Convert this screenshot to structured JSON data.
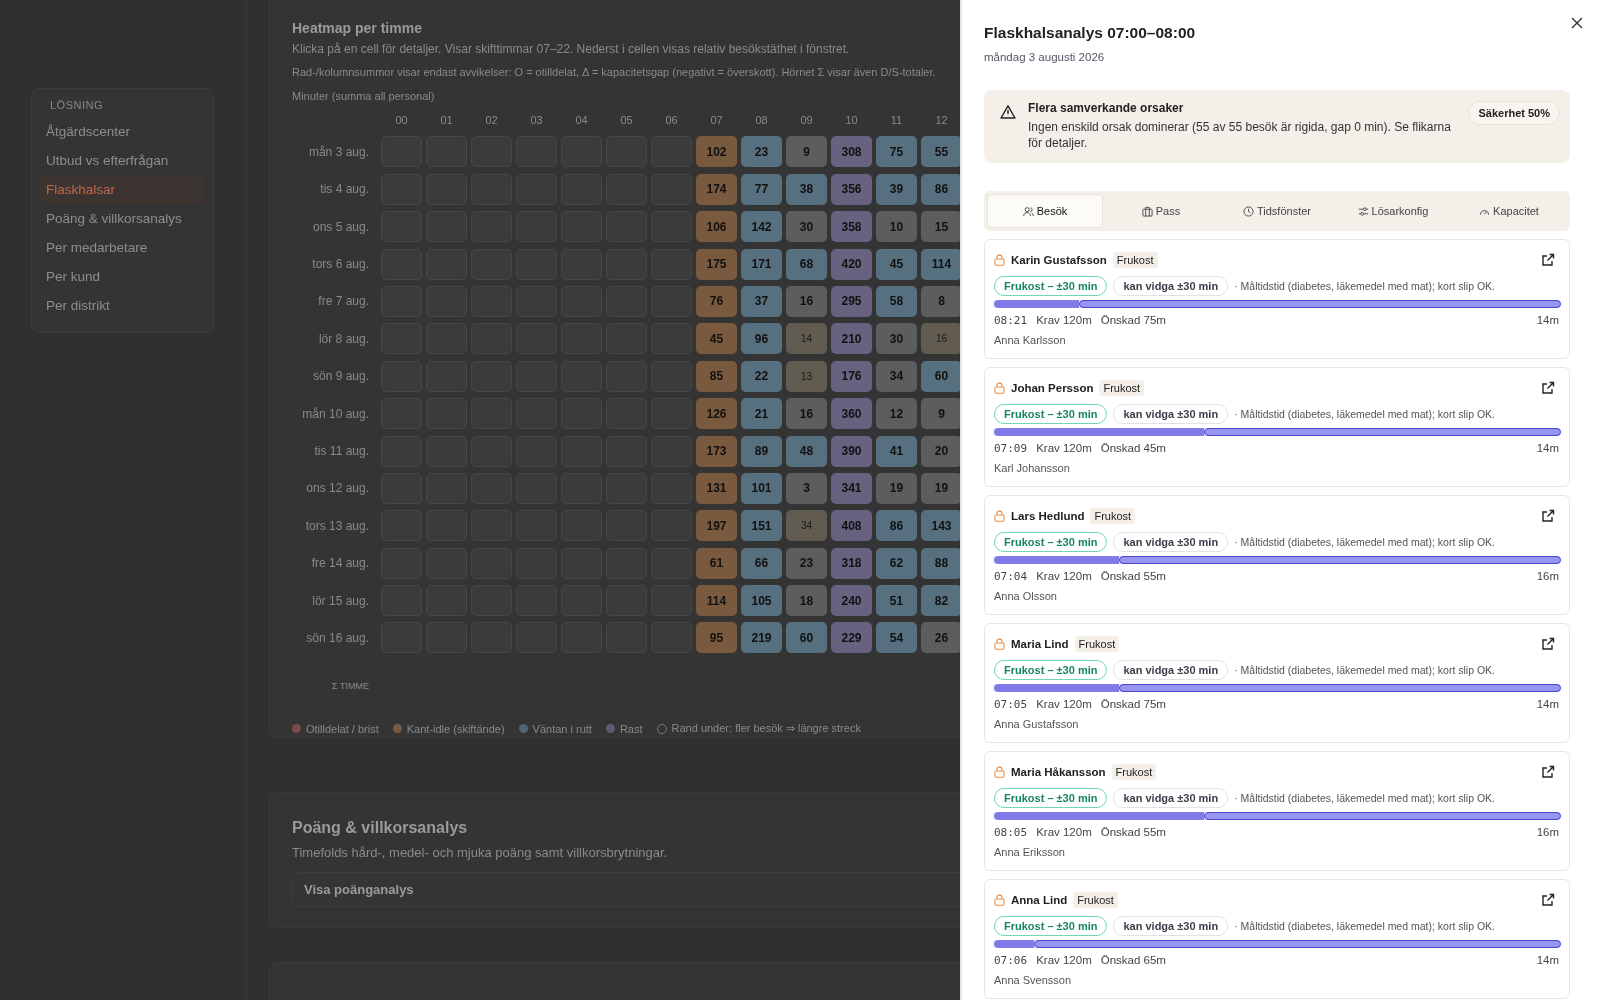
{
  "sidebar": {
    "heading": "LÖSNING",
    "items": [
      {
        "label": "Åtgärdscenter",
        "selected": false
      },
      {
        "label": "Utbud vs efterfrågan",
        "selected": false
      },
      {
        "label": "Flaskhalsar",
        "selected": true
      },
      {
        "label": "Poäng & villkorsanalys",
        "selected": false
      },
      {
        "label": "Per medarbetare",
        "selected": false
      },
      {
        "label": "Per kund",
        "selected": false
      },
      {
        "label": "Per distrikt",
        "selected": false
      }
    ]
  },
  "heatmap": {
    "title": "Heatmap per timme",
    "description": "Klicka på en cell för detaljer. Visar skifttimmar 07–22. Nederst i cellen visas relativ besökstäthet i fönstret.",
    "note": "Rad-/kolumnsummor visar endast avvikelser: O = otilldelat, Δ = kapacitetsgap (negativt = överskott). Hörnet Σ visar även D/S-totaler.",
    "unit_label": "Minuter (summa all personal)",
    "hours": [
      "00",
      "01",
      "02",
      "03",
      "04",
      "05",
      "06",
      "07",
      "08",
      "09",
      "10",
      "11",
      "12"
    ],
    "rows": [
      {
        "day": "mån 3 aug.",
        "cells": [
          {
            "value": "102",
            "kind": "kant"
          },
          {
            "value": "23",
            "kind": "vantan"
          },
          {
            "value": "9",
            "kind": "neutral"
          },
          {
            "value": "308",
            "kind": "rast"
          },
          {
            "value": "75",
            "kind": "vantan"
          },
          {
            "value": "55",
            "kind": "vantan"
          }
        ]
      },
      {
        "day": "tis 4 aug.",
        "cells": [
          {
            "value": "174",
            "kind": "kant"
          },
          {
            "value": "77",
            "kind": "vantan"
          },
          {
            "value": "38",
            "kind": "vantan"
          },
          {
            "value": "356",
            "kind": "rast"
          },
          {
            "value": "39",
            "kind": "vantan"
          },
          {
            "value": "86",
            "kind": "vantan"
          }
        ]
      },
      {
        "day": "ons 5 aug.",
        "cells": [
          {
            "value": "106",
            "kind": "kant"
          },
          {
            "value": "142",
            "kind": "vantan"
          },
          {
            "value": "30",
            "kind": "neutral"
          },
          {
            "value": "358",
            "kind": "rast"
          },
          {
            "value": "10",
            "kind": "neutral"
          },
          {
            "value": "15",
            "kind": "neutral"
          }
        ]
      },
      {
        "day": "tors 6 aug.",
        "cells": [
          {
            "value": "175",
            "kind": "kant"
          },
          {
            "value": "171",
            "kind": "vantan"
          },
          {
            "value": "68",
            "kind": "vantan"
          },
          {
            "value": "420",
            "kind": "rast"
          },
          {
            "value": "45",
            "kind": "vantan"
          },
          {
            "value": "114",
            "kind": "vantan"
          }
        ]
      },
      {
        "day": "fre 7 aug.",
        "cells": [
          {
            "value": "76",
            "kind": "kant"
          },
          {
            "value": "37",
            "kind": "vantan"
          },
          {
            "value": "16",
            "kind": "neutral"
          },
          {
            "value": "295",
            "kind": "rast"
          },
          {
            "value": "58",
            "kind": "vantan"
          },
          {
            "value": "8",
            "kind": "neutral"
          }
        ]
      },
      {
        "day": "lör 8 aug.",
        "cells": [
          {
            "value": "45",
            "kind": "kant"
          },
          {
            "value": "96",
            "kind": "vantan"
          },
          {
            "value": "14",
            "kind": "weak"
          },
          {
            "value": "210",
            "kind": "rast"
          },
          {
            "value": "30",
            "kind": "neutral"
          },
          {
            "value": "16",
            "kind": "weak"
          }
        ]
      },
      {
        "day": "sön 9 aug.",
        "cells": [
          {
            "value": "85",
            "kind": "kant"
          },
          {
            "value": "22",
            "kind": "vantan"
          },
          {
            "value": "13",
            "kind": "weak"
          },
          {
            "value": "176",
            "kind": "rast"
          },
          {
            "value": "34",
            "kind": "neutral"
          },
          {
            "value": "60",
            "kind": "vantan"
          }
        ]
      },
      {
        "day": "mån 10 aug.",
        "cells": [
          {
            "value": "126",
            "kind": "kant"
          },
          {
            "value": "21",
            "kind": "vantan"
          },
          {
            "value": "16",
            "kind": "neutral"
          },
          {
            "value": "360",
            "kind": "rast"
          },
          {
            "value": "12",
            "kind": "neutral"
          },
          {
            "value": "9",
            "kind": "neutral"
          }
        ]
      },
      {
        "day": "tis 11 aug.",
        "cells": [
          {
            "value": "173",
            "kind": "kant"
          },
          {
            "value": "89",
            "kind": "vantan"
          },
          {
            "value": "48",
            "kind": "vantan"
          },
          {
            "value": "390",
            "kind": "rast"
          },
          {
            "value": "41",
            "kind": "vantan"
          },
          {
            "value": "20",
            "kind": "neutral"
          }
        ]
      },
      {
        "day": "ons 12 aug.",
        "cells": [
          {
            "value": "131",
            "kind": "kant"
          },
          {
            "value": "101",
            "kind": "vantan"
          },
          {
            "value": "3",
            "kind": "neutral"
          },
          {
            "value": "341",
            "kind": "rast"
          },
          {
            "value": "19",
            "kind": "neutral"
          },
          {
            "value": "19",
            "kind": "neutral"
          }
        ]
      },
      {
        "day": "tors 13 aug.",
        "cells": [
          {
            "value": "197",
            "kind": "kant"
          },
          {
            "value": "151",
            "kind": "vantan"
          },
          {
            "value": "34",
            "kind": "weak"
          },
          {
            "value": "408",
            "kind": "rast"
          },
          {
            "value": "86",
            "kind": "vantan"
          },
          {
            "value": "143",
            "kind": "vantan"
          }
        ]
      },
      {
        "day": "fre 14 aug.",
        "cells": [
          {
            "value": "61",
            "kind": "kant"
          },
          {
            "value": "66",
            "kind": "vantan"
          },
          {
            "value": "23",
            "kind": "neutral"
          },
          {
            "value": "318",
            "kind": "rast"
          },
          {
            "value": "62",
            "kind": "vantan"
          },
          {
            "value": "88",
            "kind": "vantan"
          }
        ]
      },
      {
        "day": "lör 15 aug.",
        "cells": [
          {
            "value": "114",
            "kind": "kant"
          },
          {
            "value": "105",
            "kind": "vantan"
          },
          {
            "value": "18",
            "kind": "neutral"
          },
          {
            "value": "240",
            "kind": "rast"
          },
          {
            "value": "51",
            "kind": "vantan"
          },
          {
            "value": "82",
            "kind": "vantan"
          }
        ]
      },
      {
        "day": "sön 16 aug.",
        "cells": [
          {
            "value": "95",
            "kind": "kant"
          },
          {
            "value": "219",
            "kind": "vantan"
          },
          {
            "value": "60",
            "kind": "vantan"
          },
          {
            "value": "229",
            "kind": "rast"
          },
          {
            "value": "54",
            "kind": "vantan"
          },
          {
            "value": "26",
            "kind": "neutral"
          }
        ]
      }
    ],
    "sum_label": "Σ TIMME",
    "legend": [
      {
        "label": "Otilldelat / brist",
        "kind": "dot",
        "color": "#7a4a4c"
      },
      {
        "label": "Kant-idle (skiftände)",
        "kind": "dot",
        "color": "#7a5a3e"
      },
      {
        "label": "Väntan i rutt",
        "kind": "dot",
        "color": "#4f6576"
      },
      {
        "label": "Rast",
        "kind": "dot",
        "color": "#5d5a78"
      },
      {
        "label": "Rand under: fler besök ⇒ längre streck",
        "kind": "ring"
      }
    ]
  },
  "score_section": {
    "title": "Poäng & villkorsanalys",
    "description": "Timefolds hård-, medel- och mjuka poäng samt villkorsbrytningar.",
    "button": "Visa poänganalys"
  },
  "drawer": {
    "title": "Flaskhalsanalys 07:00–08:00",
    "date": "måndag 3 augusti 2026",
    "alert": {
      "title": "Flera samverkande orsaker",
      "text": "Ingen enskild orsak dominerar (55 av 55 besök är rigida, gap 0 min). Se flikarna för detaljer.",
      "badge": "Säkerhet 50%"
    },
    "tabs": [
      {
        "label": "Besök",
        "selected": true
      },
      {
        "label": "Pass",
        "selected": false
      },
      {
        "label": "Tidsfönster",
        "selected": false
      },
      {
        "label": "Lösarkonfig",
        "selected": false
      },
      {
        "label": "Kapacitet",
        "selected": false
      }
    ],
    "visits": [
      {
        "client": "Karin Gustafsson",
        "tag": "Frukost",
        "window": "Frukost – ±30 min",
        "widen": "kan vidga ±30 min",
        "note": "· Måltidstid (diabetes, läkemedel med mat); kort slip OK.",
        "level": 0.15,
        "time": "08:21",
        "required": "Krav 120m",
        "wished": "Önskad 75m",
        "duration": "14m",
        "staff": "Anna Karlsson"
      },
      {
        "client": "Johan Persson",
        "tag": "Frukost",
        "window": "Frukost – ±30 min",
        "widen": "kan vidga ±30 min",
        "note": "· Måltidstid (diabetes, läkemedel med mat); kort slip OK.",
        "level": 0.37,
        "time": "07:09",
        "required": "Krav 120m",
        "wished": "Önskad 45m",
        "duration": "14m",
        "staff": "Karl Johansson"
      },
      {
        "client": "Lars Hedlund",
        "tag": "Frukost",
        "window": "Frukost – ±30 min",
        "widen": "kan vidga ±30 min",
        "note": "· Måltidstid (diabetes, läkemedel med mat); kort slip OK.",
        "level": 0.22,
        "time": "07:04",
        "required": "Krav 120m",
        "wished": "Önskad 55m",
        "duration": "16m",
        "staff": "Anna Olsson"
      },
      {
        "client": "Maria Lind",
        "tag": "Frukost",
        "window": "Frukost – ±30 min",
        "widen": "kan vidga ±30 min",
        "note": "· Måltidstid (diabetes, läkemedel med mat); kort slip OK.",
        "level": 0.22,
        "time": "07:05",
        "required": "Krav 120m",
        "wished": "Önskad 75m",
        "duration": "14m",
        "staff": "Anna Gustafsson"
      },
      {
        "client": "Maria Håkansson",
        "tag": "Frukost",
        "window": "Frukost – ±30 min",
        "widen": "kan vidga ±30 min",
        "note": "· Måltidstid (diabetes, läkemedel med mat); kort slip OK.",
        "level": 0.37,
        "time": "08:05",
        "required": "Krav 120m",
        "wished": "Önskad 55m",
        "duration": "16m",
        "staff": "Anna Eriksson"
      },
      {
        "client": "Anna Lind",
        "tag": "Frukost",
        "window": "Frukost – ±30 min",
        "widen": "kan vidga ±30 min",
        "note": "· Måltidstid (diabetes, läkemedel med mat); kort slip OK.",
        "level": 0.07,
        "time": "07:06",
        "required": "Krav 120m",
        "wished": "Önskad 65m",
        "duration": "14m",
        "staff": "Anna Svensson"
      }
    ]
  }
}
